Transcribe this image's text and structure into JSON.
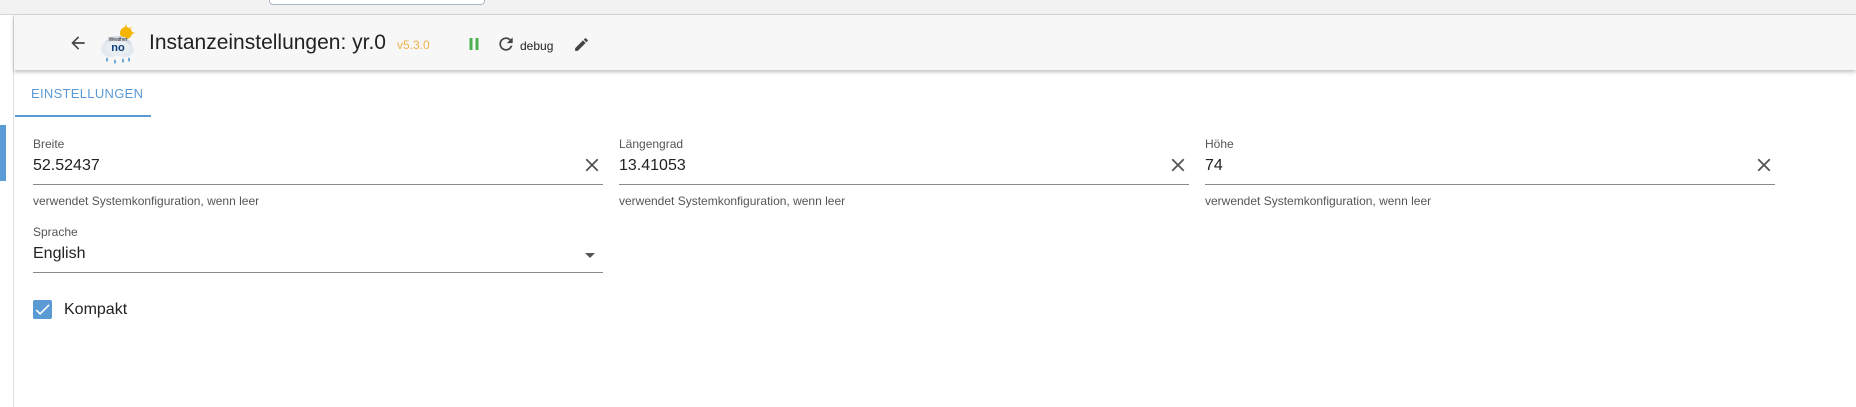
{
  "header": {
    "title": "Instanzeinstellungen: yr.0",
    "version": "v5.3.0",
    "log_level": "debug",
    "logo_text": "no",
    "logo_caption": "Weather"
  },
  "tabs": [
    {
      "label": "EINSTELLUNGEN"
    }
  ],
  "fields": {
    "latitude": {
      "label": "Breite",
      "value": "52.52437",
      "helper": "verwendet Systemkonfiguration, wenn leer"
    },
    "longitude": {
      "label": "Längengrad",
      "value": "13.41053",
      "helper": "verwendet Systemkonfiguration, wenn leer"
    },
    "altitude": {
      "label": "Höhe",
      "value": "74",
      "helper": "verwendet Systemkonfiguration, wenn leer"
    },
    "language": {
      "label": "Sprache",
      "value": "English"
    }
  },
  "compact": {
    "label": "Kompakt",
    "checked": true
  },
  "colors": {
    "accent": "#5b9bd5",
    "version": "#f0b14a",
    "running": "#4caf50"
  },
  "icons": {
    "back": "arrow-left",
    "pause": "pause",
    "reload": "refresh",
    "edit": "pencil",
    "clear": "close",
    "dropdown": "triangle-down",
    "checkbox": "checkmark"
  }
}
